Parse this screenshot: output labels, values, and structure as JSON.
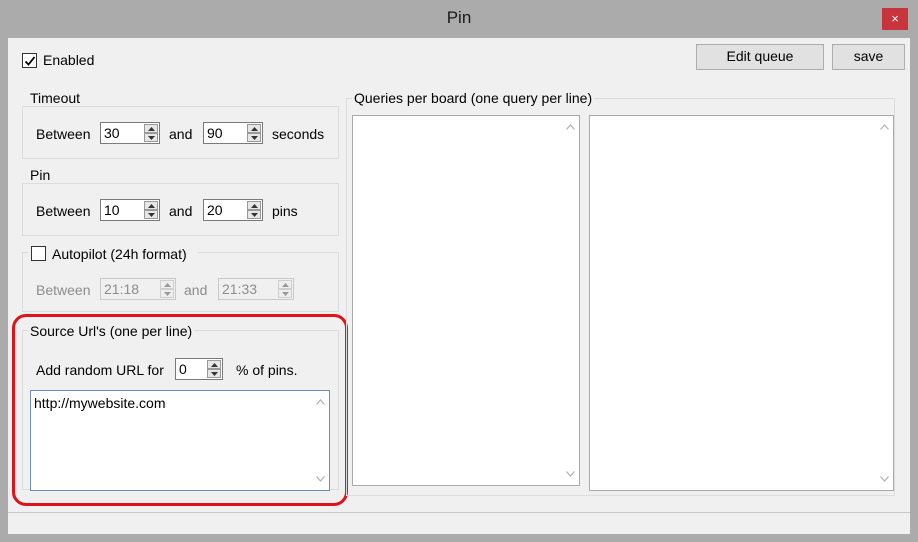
{
  "window": {
    "title": "Pin",
    "close_glyph": "×"
  },
  "enabled": {
    "label": "Enabled",
    "checked": true
  },
  "toolbar": {
    "edit_queue_label": "Edit queue",
    "save_label": "save"
  },
  "timeout": {
    "title": "Timeout",
    "between": "Between",
    "min": "30",
    "and": "and",
    "max": "90",
    "unit": "seconds"
  },
  "pin": {
    "title": "Pin",
    "between": "Between",
    "min": "10",
    "and": "and",
    "max": "20",
    "unit": "pins"
  },
  "autopilot": {
    "label": "Autopilot (24h format)",
    "checked": false,
    "between": "Between",
    "start": "21:18",
    "and": "and",
    "end": "21:33"
  },
  "source": {
    "title": "Source Url's (one per line)",
    "random_prefix": "Add random URL for",
    "random_value": "0",
    "random_suffix": "% of pins.",
    "urls": "http://mywebsite.com"
  },
  "queries": {
    "title": "Queries per board (one query per line)",
    "left_text": "",
    "right_text": ""
  },
  "colors": {
    "highlight": "#e0121a",
    "close_button": "#c8343c",
    "window_frame": "#ababab",
    "client_bg": "#f0f0f0"
  }
}
